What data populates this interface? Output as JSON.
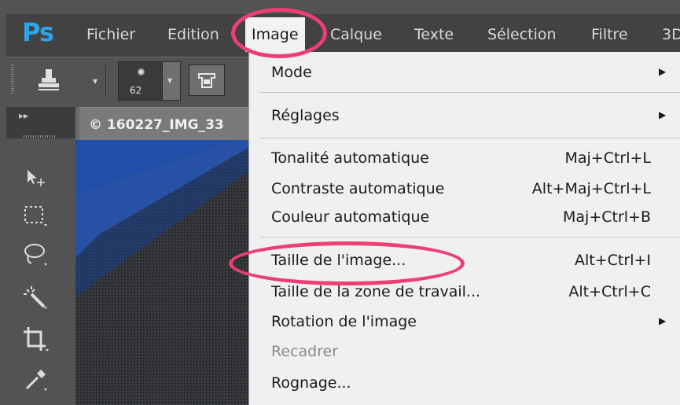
{
  "app": {
    "logo": "Ps",
    "menu": [
      "Fichier",
      "Edition",
      "Image",
      "Calque",
      "Texte",
      "Sélection",
      "Filtre",
      "3D"
    ],
    "active_menu_index": 2,
    "accent": "#2fa3e8",
    "highlight_color": "#ee3e74"
  },
  "options_bar": {
    "brush_size": "62",
    "stamp_icon": "clone-stamp-icon",
    "tool_icon": "clone-source-icon"
  },
  "document_tab": {
    "title": "© 160227_IMG_33"
  },
  "toolbar": {
    "tools": [
      "move-tool-icon",
      "marquee-tool-icon",
      "lasso-tool-icon",
      "magic-wand-icon",
      "crop-tool-icon",
      "eyedropper-icon"
    ]
  },
  "image_menu": {
    "items": [
      {
        "label": "Mode",
        "shortcut": "",
        "submenu": true,
        "disabled": false
      },
      {
        "label": "Réglages",
        "shortcut": "",
        "submenu": true,
        "disabled": false
      },
      {
        "label": "Tonalité automatique",
        "shortcut": "Maj+Ctrl+L",
        "submenu": false,
        "disabled": false
      },
      {
        "label": "Contraste automatique",
        "shortcut": "Alt+Maj+Ctrl+L",
        "submenu": false,
        "disabled": false
      },
      {
        "label": "Couleur automatique",
        "shortcut": "Maj+Ctrl+B",
        "submenu": false,
        "disabled": false
      },
      {
        "label": "Taille de l'image...",
        "shortcut": "Alt+Ctrl+I",
        "submenu": false,
        "disabled": false
      },
      {
        "label": "Taille de la zone de travail...",
        "shortcut": "Alt+Ctrl+C",
        "submenu": false,
        "disabled": false
      },
      {
        "label": "Rotation de l'image",
        "shortcut": "",
        "submenu": true,
        "disabled": false
      },
      {
        "label": "Recadrer",
        "shortcut": "",
        "submenu": false,
        "disabled": true
      },
      {
        "label": "Rognage...",
        "shortcut": "",
        "submenu": false,
        "disabled": false
      }
    ]
  }
}
